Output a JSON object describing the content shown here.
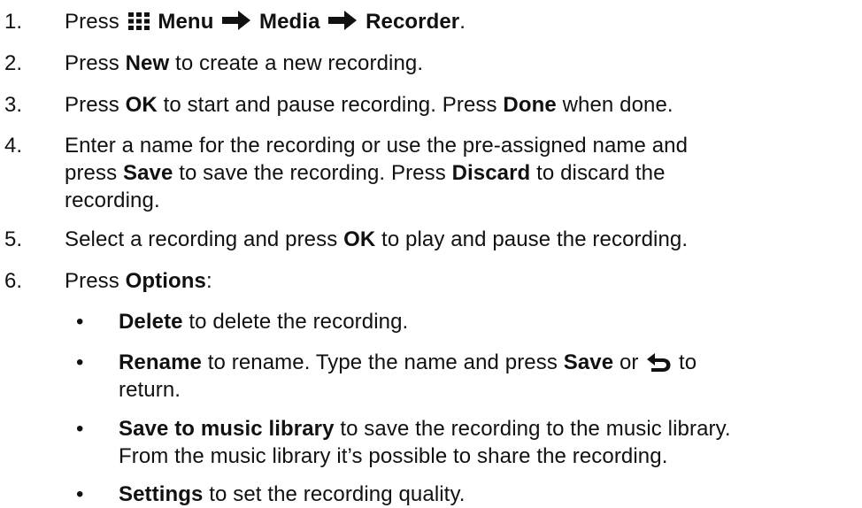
{
  "steps": [
    {
      "number": "1.",
      "lines": [
        {
          "segments": [
            {
              "text": "Press ",
              "bold": false
            },
            {
              "icon": "menu-grid-icon"
            },
            {
              "text": " Menu ",
              "bold": true
            },
            {
              "icon": "arrow-right-icon"
            },
            {
              "text": " Media ",
              "bold": true
            },
            {
              "icon": "arrow-right-icon"
            },
            {
              "text": " Recorder",
              "bold": true
            },
            {
              "text": ".",
              "bold": false
            }
          ]
        }
      ]
    },
    {
      "number": "2.",
      "lines": [
        {
          "segments": [
            {
              "text": "Press ",
              "bold": false
            },
            {
              "text": "New",
              "bold": true
            },
            {
              "text": " to create a new recording.",
              "bold": false
            }
          ]
        }
      ]
    },
    {
      "number": "3.",
      "lines": [
        {
          "segments": [
            {
              "text": "Press ",
              "bold": false
            },
            {
              "text": "OK",
              "bold": true
            },
            {
              "text": " to start and pause recording. Press ",
              "bold": false
            },
            {
              "text": "Done",
              "bold": true
            },
            {
              "text": " when done.",
              "bold": false
            }
          ]
        }
      ]
    },
    {
      "number": "4.",
      "lines": [
        {
          "segments": [
            {
              "text": "Enter a name for the recording or use the pre-assigned name and",
              "bold": false
            }
          ]
        },
        {
          "segments": [
            {
              "text": "press ",
              "bold": false
            },
            {
              "text": "Save",
              "bold": true
            },
            {
              "text": " to save the recording. Press ",
              "bold": false
            },
            {
              "text": "Discard",
              "bold": true
            },
            {
              "text": " to discard the",
              "bold": false
            }
          ]
        },
        {
          "segments": [
            {
              "text": "recording.",
              "bold": false
            }
          ]
        }
      ]
    },
    {
      "number": "5.",
      "lines": [
        {
          "segments": [
            {
              "text": "Select a recording and press ",
              "bold": false
            },
            {
              "text": "OK",
              "bold": true
            },
            {
              "text": " to play and pause the recording.",
              "bold": false
            }
          ]
        }
      ]
    },
    {
      "number": "6.",
      "lines": [
        {
          "segments": [
            {
              "text": "Press ",
              "bold": false
            },
            {
              "text": "Options",
              "bold": true
            },
            {
              "text": ":",
              "bold": false
            }
          ]
        }
      ]
    }
  ],
  "options": [
    {
      "bullet": "•",
      "lines": [
        {
          "segments": [
            {
              "text": "Delete",
              "bold": true
            },
            {
              "text": " to delete the recording.",
              "bold": false
            }
          ]
        }
      ]
    },
    {
      "bullet": "•",
      "lines": [
        {
          "segments": [
            {
              "text": "Rename",
              "bold": true
            },
            {
              "text": " to rename. Type the name and press ",
              "bold": false
            },
            {
              "text": "Save",
              "bold": true
            },
            {
              "text": " or ",
              "bold": false
            },
            {
              "icon": "back-arrow-icon"
            },
            {
              "text": " to",
              "bold": false
            }
          ]
        },
        {
          "segments": [
            {
              "text": "return.",
              "bold": false
            }
          ]
        }
      ]
    },
    {
      "bullet": "•",
      "lines": [
        {
          "segments": [
            {
              "text": "Save to music library",
              "bold": true
            },
            {
              "text": " to save the recording to the music library.",
              "bold": false
            }
          ]
        },
        {
          "segments": [
            {
              "text": "From the music library it’s possible to share the recording.",
              "bold": false
            }
          ]
        }
      ]
    },
    {
      "bullet": "•",
      "lines": [
        {
          "segments": [
            {
              "text": "Settings",
              "bold": true
            },
            {
              "text": " to set the recording quality.",
              "bold": false
            }
          ]
        }
      ]
    }
  ]
}
